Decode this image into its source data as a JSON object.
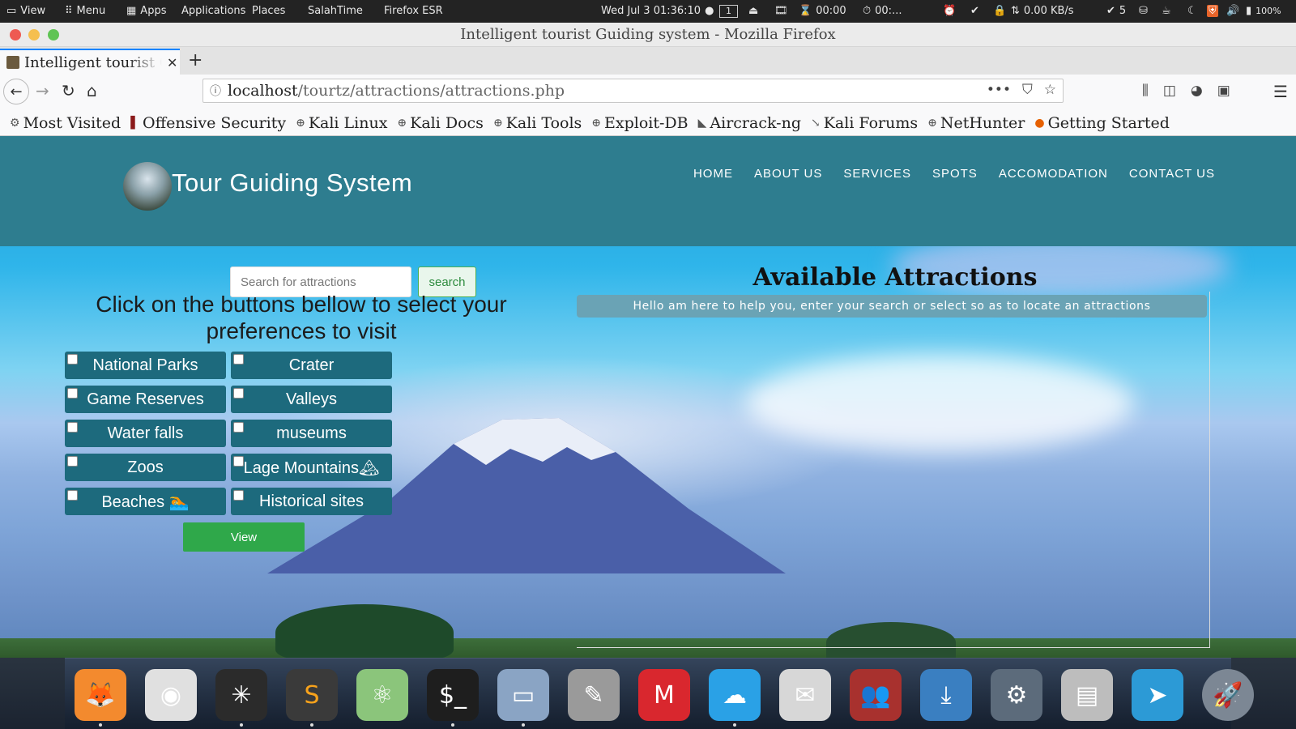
{
  "system_panel": {
    "view_label": "View",
    "menu_label": "Menu",
    "apps_label": "Apps",
    "applications_label": "Applications",
    "places_label": "Places",
    "salah_label": "SalahTime",
    "firefox_label": "Firefox ESR",
    "datetime": "Wed Jul 3  01:36:10",
    "workspace": "1",
    "timer1": "00:00",
    "timer2": "00:...",
    "net_speed": "0.00 KB/s",
    "updates_count": "5",
    "battery": "100%"
  },
  "window": {
    "title": "Intelligent tourist Guiding system - Mozilla Firefox"
  },
  "tab": {
    "title": "Intelligent tourist Guiding system"
  },
  "url": {
    "host": "localhost",
    "path": "/tourtz/attractions/attractions.php"
  },
  "bookmarks": [
    {
      "label": "Most Visited",
      "icon": "gear-icon"
    },
    {
      "label": "Offensive Security",
      "icon": "offsec-icon"
    },
    {
      "label": "Kali Linux",
      "icon": "globe-icon"
    },
    {
      "label": "Kali Docs",
      "icon": "globe-icon"
    },
    {
      "label": "Kali Tools",
      "icon": "globe-icon"
    },
    {
      "label": "Exploit-DB",
      "icon": "globe-icon"
    },
    {
      "label": "Aircrack-ng",
      "icon": "aircrack-icon"
    },
    {
      "label": "Kali Forums",
      "icon": "kali-icon"
    },
    {
      "label": "NetHunter",
      "icon": "globe-icon"
    },
    {
      "label": "Getting Started",
      "icon": "firefox-icon"
    }
  ],
  "site": {
    "title": "Tour Guiding System",
    "nav": [
      "HOME",
      "ABOUT US",
      "SERVICES",
      "SPOTS",
      "ACCOMODATION",
      "CONTACT US"
    ],
    "search_placeholder": "Search for attractions",
    "search_button": "search",
    "prompt": "Click on the buttons bellow to select your preferences to visit",
    "categories": [
      "National Parks",
      "Crater",
      "Game Reserves",
      "Valleys",
      "Water falls",
      "museums",
      "Zoos",
      "Lage Mountains🏔",
      "Beaches 🏊",
      "Historical sites"
    ],
    "view_button": "View",
    "available_title": "Available Attractions",
    "helper_text": "Hello am here to help you, enter your search or select so as to locate an attractions"
  },
  "colors": {
    "header_band": "#2e7d8f",
    "category_button": "#1d6a7d",
    "view_button": "#2fa84a",
    "helper_bar": "#6aa3b5"
  },
  "dock": [
    {
      "name": "firefox-icon",
      "color": "#f38a2e"
    },
    {
      "name": "chrome-icon",
      "color": "#e0e0e0"
    },
    {
      "name": "maltego-icon",
      "color": "#2b2b2b"
    },
    {
      "name": "sublime-icon",
      "color": "#3a3a3a"
    },
    {
      "name": "atom-icon",
      "color": "#8bc57b"
    },
    {
      "name": "terminal-icon",
      "color": "#1e1e1e"
    },
    {
      "name": "files-icon",
      "color": "#8aa4c4"
    },
    {
      "name": "gimp-icon",
      "color": "#9a9a9a"
    },
    {
      "name": "mega-icon",
      "color": "#d9272e"
    },
    {
      "name": "weather-icon",
      "color": "#2aa1e6"
    },
    {
      "name": "mail-icon",
      "color": "#d7d7d7"
    },
    {
      "name": "contacts-icon",
      "color": "#a8312e"
    },
    {
      "name": "download-icon",
      "color": "#3a7fc1"
    },
    {
      "name": "settings-icon",
      "color": "#5c6b7b"
    },
    {
      "name": "radio-icon",
      "color": "#bdbdbd"
    },
    {
      "name": "telegram-icon",
      "color": "#2c9ad6"
    },
    {
      "name": "launcher-icon",
      "color": "#7c8794"
    }
  ]
}
